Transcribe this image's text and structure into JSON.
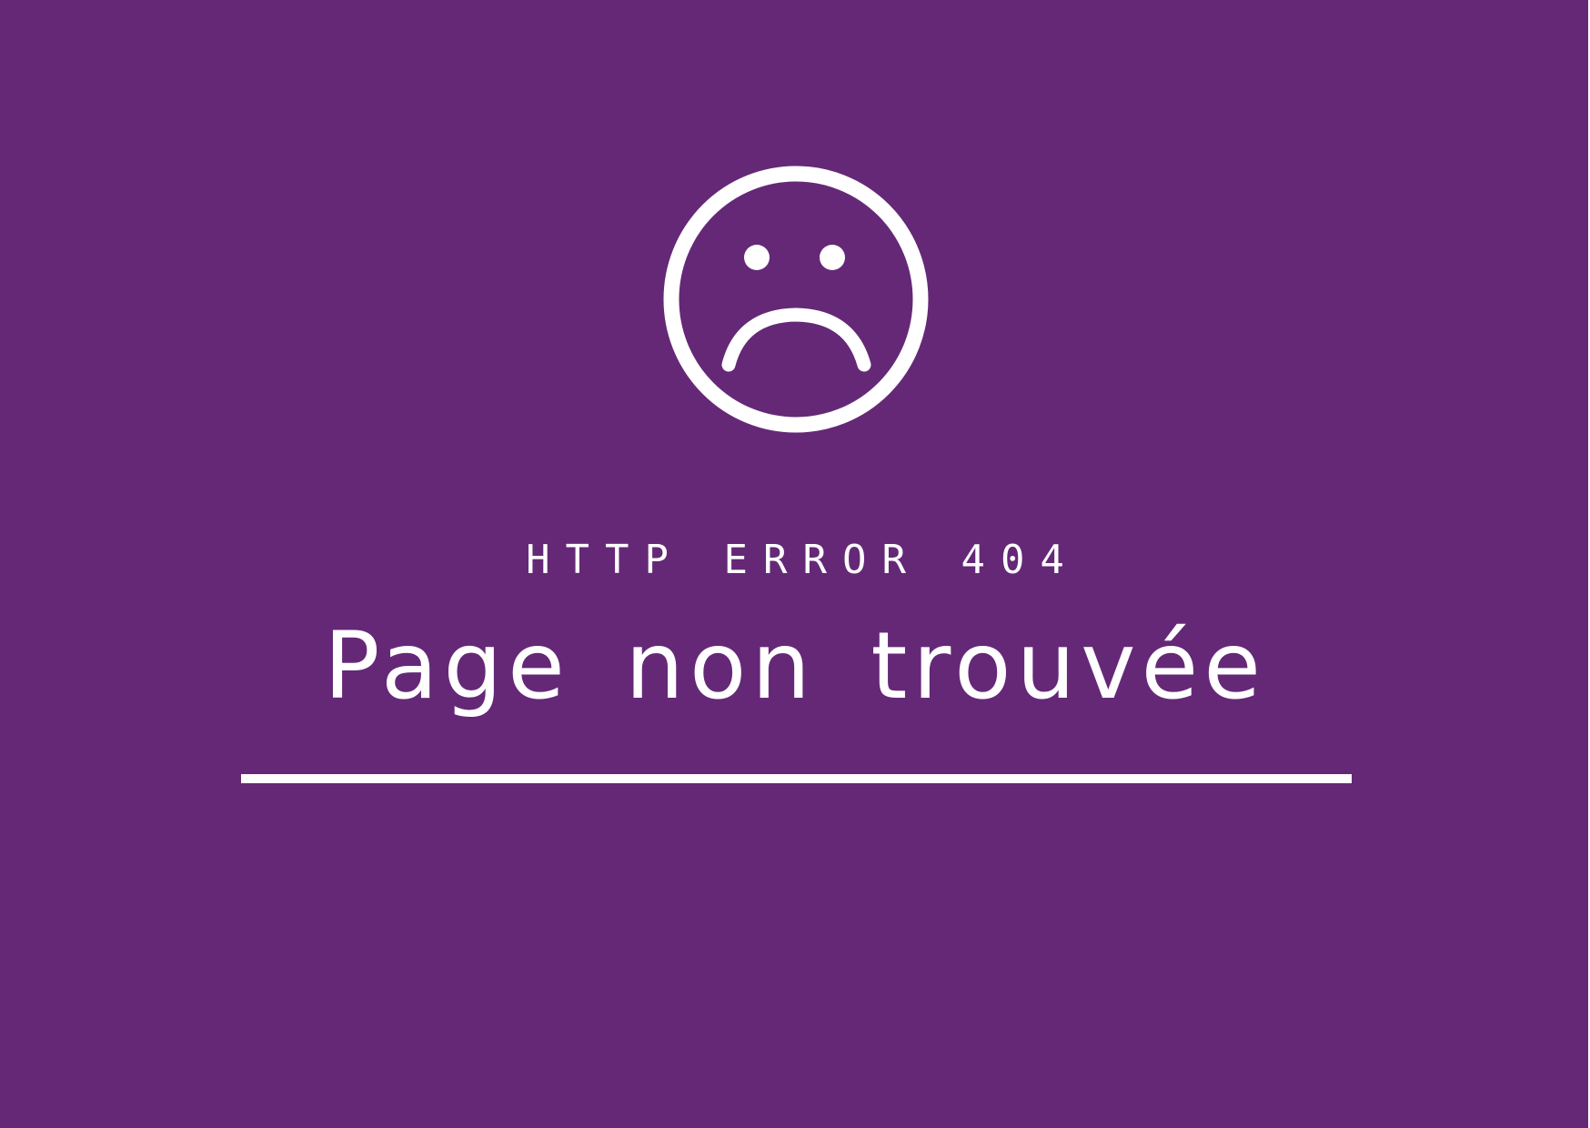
{
  "colors": {
    "background": "#652877",
    "foreground": "#ffffff"
  },
  "icon": "sad-face-icon",
  "error_code": "HTTP ERROR 404",
  "title": "Page non trouvée"
}
